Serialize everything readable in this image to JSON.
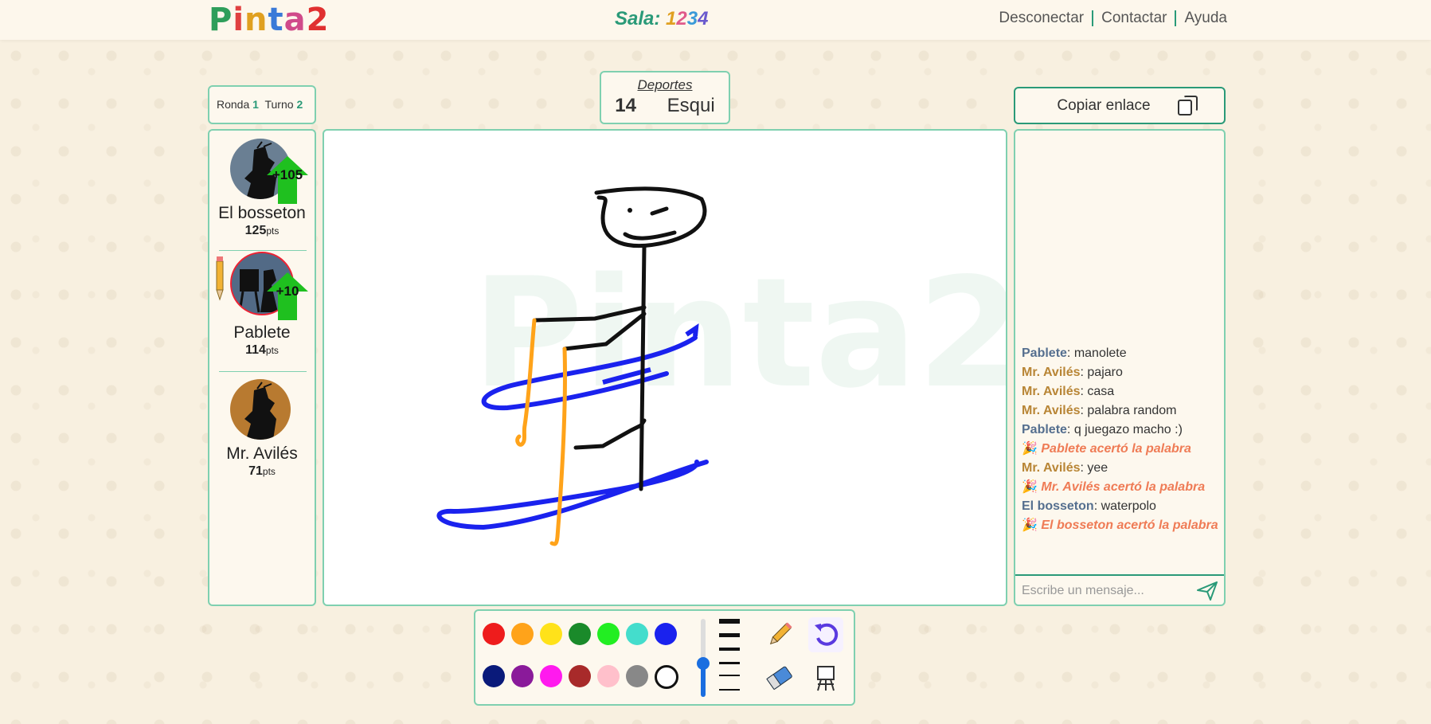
{
  "header": {
    "logo": [
      "P",
      "i",
      "n",
      "t",
      "a",
      "2"
    ],
    "logo_colors": [
      "#2e9e5a",
      "#e04040",
      "#e0a020",
      "#3a7ad8",
      "#d04a8a",
      "#e03030"
    ],
    "room_label": "Sala:",
    "room_digits": [
      "1",
      "2",
      "3",
      "4"
    ],
    "nav": [
      "Desconectar",
      "Contactar",
      "Ayuda"
    ]
  },
  "round": {
    "round_label": "Ronda",
    "round_value": "1",
    "turn_label": "Turno",
    "turn_value": "2"
  },
  "word": {
    "category": "Deportes",
    "count": "14",
    "text": "Esqui"
  },
  "copy_link": {
    "label": "Copiar enlace",
    "icon": "copy-icon"
  },
  "players": [
    {
      "name": "El bosseton",
      "points": "125",
      "unit": "pts",
      "bonus": "+105",
      "avatar_color": "#6a7f93",
      "drawing": false
    },
    {
      "name": "Pablete",
      "points": "114",
      "unit": "pts",
      "bonus": "+10",
      "avatar_color": "#526a86",
      "drawing": true
    },
    {
      "name": "Mr. Avilés",
      "points": "71",
      "unit": "pts",
      "bonus": "",
      "avatar_color": "#b87a30",
      "drawing": false
    }
  ],
  "chat": {
    "messages": [
      {
        "type": "user",
        "user": "Pablete",
        "color": "blue",
        "text": ": manolete"
      },
      {
        "type": "user",
        "user": "Mr. Avilés",
        "color": "gold",
        "text": ": pajaro"
      },
      {
        "type": "user",
        "user": "Mr. Avilés",
        "color": "gold",
        "text": ": casa"
      },
      {
        "type": "user",
        "user": "Mr. Avilés",
        "color": "gold",
        "text": ": palabra random"
      },
      {
        "type": "user",
        "user": "Pablete",
        "color": "blue",
        "text": ": q juegazo macho :)"
      },
      {
        "type": "sys",
        "text": "Pablete acertó la palabra"
      },
      {
        "type": "user",
        "user": "Mr. Avilés",
        "color": "gold",
        "text": ": yee"
      },
      {
        "type": "sys",
        "text": "Mr. Avilés acertó la palabra"
      },
      {
        "type": "user",
        "user": "El bosseton",
        "color": "blue",
        "text": ": waterpolo"
      },
      {
        "type": "sys",
        "text": "El bosseton acertó la palabra"
      }
    ],
    "placeholder": "Escribe un mensaje...",
    "send_icon": "send-icon",
    "celebration_icon": "party-icon"
  },
  "palette": {
    "row1": [
      "#ee1c1c",
      "#ffa31a",
      "#ffe21a",
      "#1a8a2a",
      "#22ee22",
      "#44ddcc",
      "#1a22ee"
    ],
    "row2": [
      "#0a1a7a",
      "#8a1a9a",
      "#ff1aee",
      "#a82a2a",
      "#ffc0cb",
      "#888888",
      "#ffffff"
    ],
    "brush_level_percent": 50,
    "tools": [
      "pencil-icon",
      "undo-icon",
      "eraser-icon",
      "easel-icon"
    ]
  },
  "canvas": {
    "watermark": "Pinta2"
  }
}
